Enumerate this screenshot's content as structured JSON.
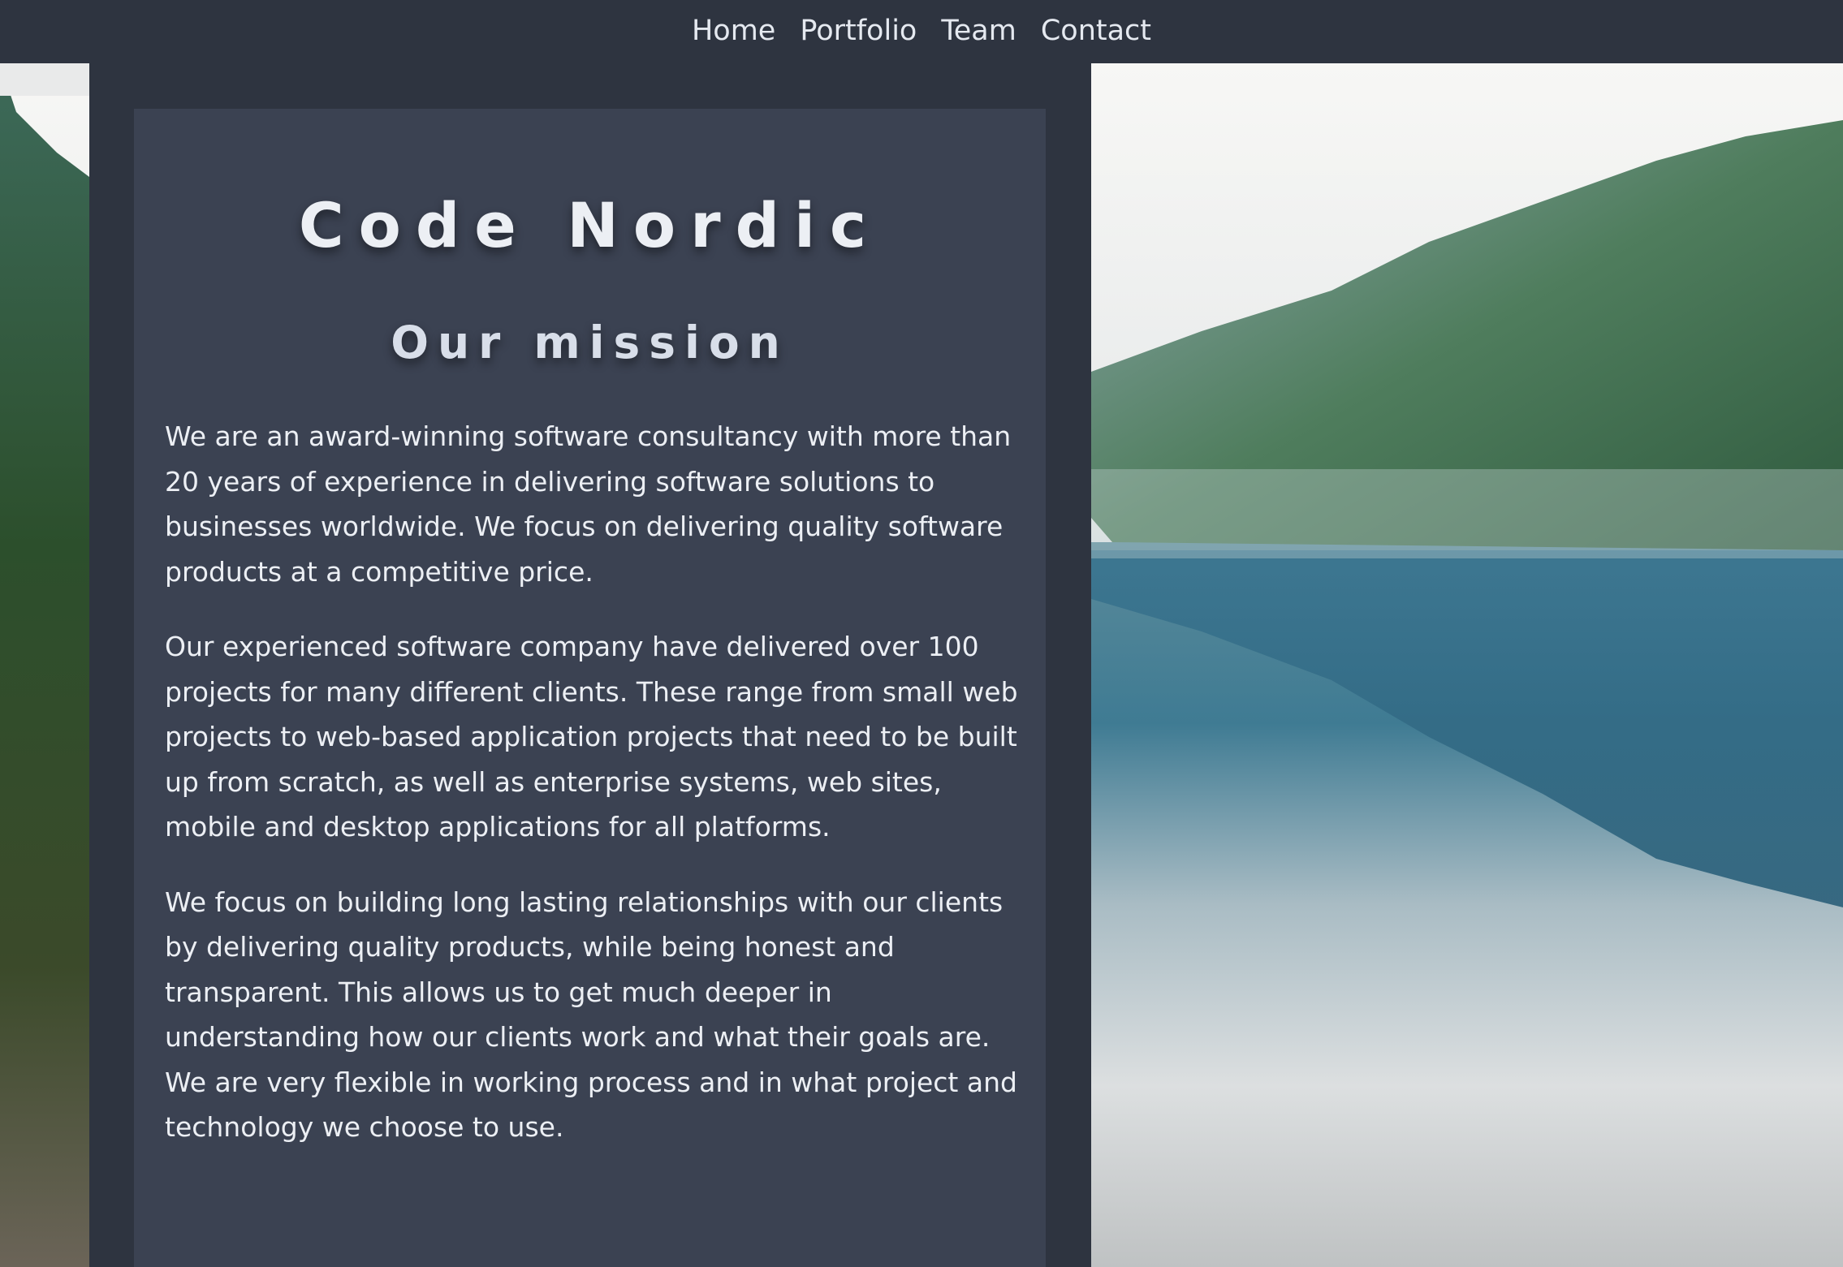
{
  "nav": {
    "items": [
      {
        "label": "Home"
      },
      {
        "label": "Portfolio"
      },
      {
        "label": "Team"
      },
      {
        "label": "Contact"
      }
    ]
  },
  "hero": {
    "title": "Code Nordic",
    "subtitle": "Our mission",
    "paragraphs": [
      "We are an award-winning software consultancy with more than 20 years of experience in delivering software solutions to businesses worldwide. We focus on delivering quality software products at a competitive price.",
      "Our experienced software company have delivered over 100 projects for many different clients. These range from small web projects to web-based application projects that need to be built up from scratch, as well as enterprise systems, web sites, mobile and desktop applications for all platforms.",
      "We focus on building long lasting relationships with our clients by delivering quality products, while being honest and transparent. This allows us to get much deeper in understanding how our clients work and what their goals are. We are very flexible in working process and in what project and technology we choose to use."
    ]
  },
  "colors": {
    "nav_bg": "#2e3440",
    "column_bg": "#2e3440",
    "card_bg": "#3b4252",
    "text": "#eceff4"
  }
}
